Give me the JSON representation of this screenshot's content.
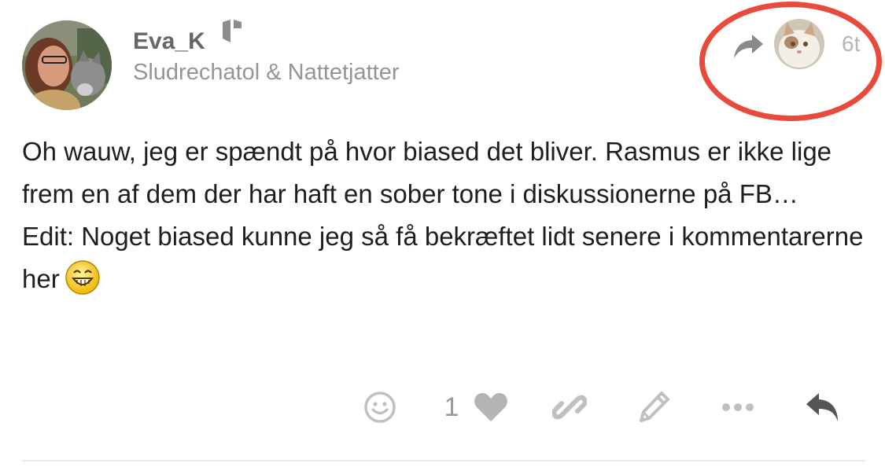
{
  "post": {
    "author": {
      "username": "Eva_K",
      "title": "Sludrechatol & Nattetjatter",
      "avatar_icon": "user-avatar-photo",
      "badge_icon": "shield-badge-icon"
    },
    "reply_to": {
      "arrow_icon": "share-forward-icon",
      "avatar_icon": "cat-avatar-photo"
    },
    "date": "6t",
    "body": {
      "lines": [
        "Oh wauw, jeg er spændt på hvor biased det bliver. Rasmus er ikke lige frem en af dem der har haft en sober tone i diskussionerne på FB…",
        "Edit: Noget biased kunne jeg så få bekræftet lidt senere i kommentarerne her"
      ],
      "emoji": "grinning-emoji"
    },
    "actions": {
      "like_count": "1",
      "icons": [
        "smiley-icon",
        "heart-icon",
        "link-icon",
        "pencil-icon",
        "more-icon",
        "reply-icon"
      ]
    },
    "colors": {
      "highlight": "#e84a3b",
      "muted": "#959595",
      "icon": "#c0c0c0",
      "reply_icon": "#555555"
    }
  }
}
